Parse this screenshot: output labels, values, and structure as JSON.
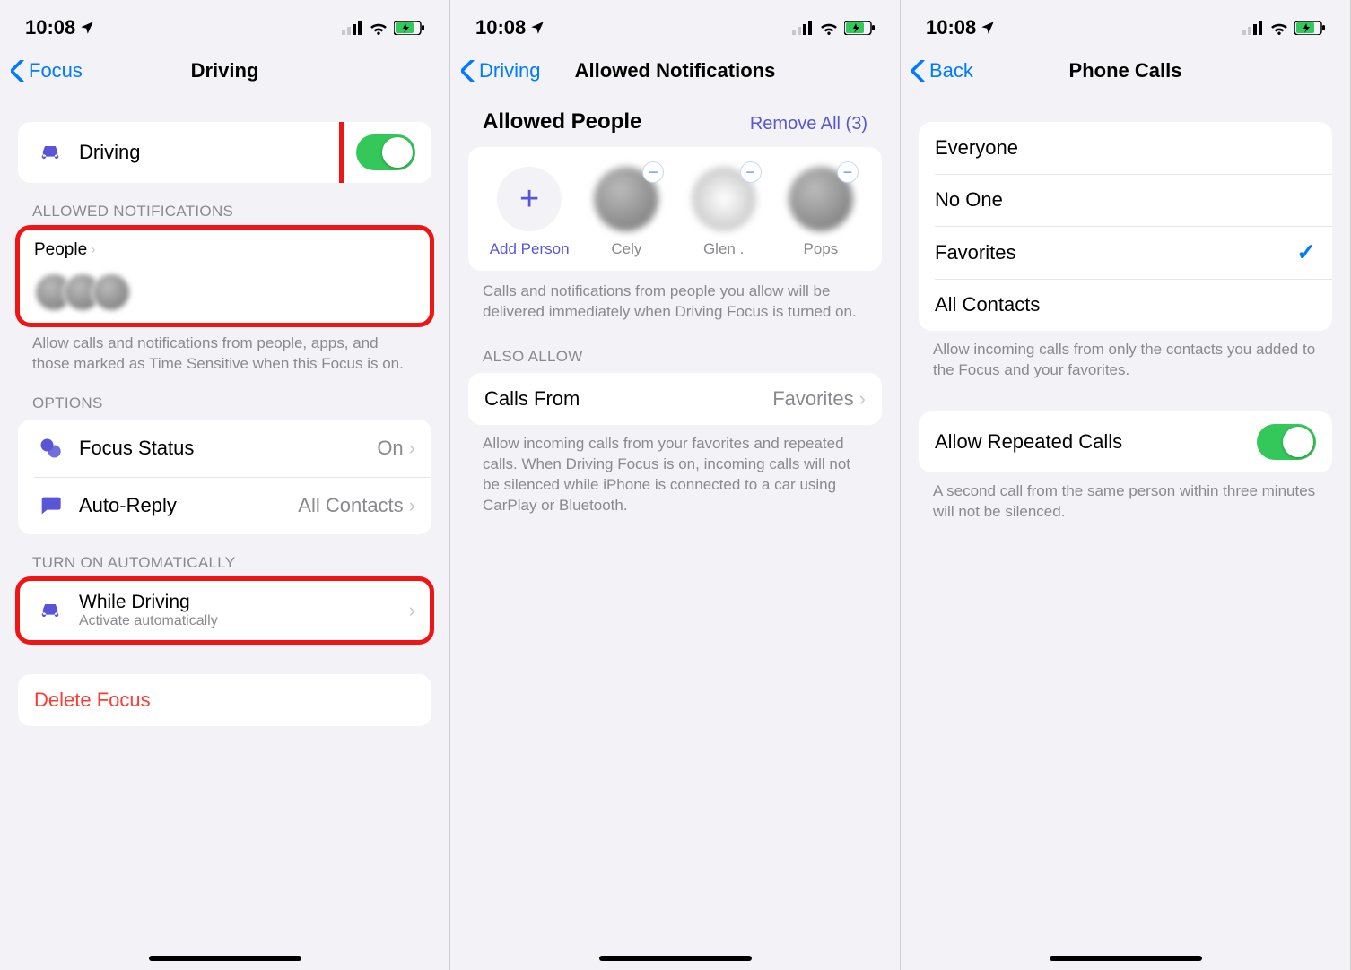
{
  "status": {
    "time": "10:08"
  },
  "screen1": {
    "back": "Focus",
    "title": "Driving",
    "toggle_row": {
      "label": "Driving",
      "on": true
    },
    "allowed_header": "ALLOWED NOTIFICATIONS",
    "people_row": {
      "label": "People"
    },
    "allowed_footer": "Allow calls and notifications from people, apps, and those marked as Time Sensitive when this Focus is on.",
    "options_header": "OPTIONS",
    "focus_status": {
      "label": "Focus Status",
      "value": "On"
    },
    "auto_reply": {
      "label": "Auto-Reply",
      "value": "All Contacts"
    },
    "auto_header": "TURN ON AUTOMATICALLY",
    "while_driving": {
      "label": "While Driving",
      "sub": "Activate automatically"
    },
    "delete": "Delete Focus"
  },
  "screen2": {
    "back": "Driving",
    "title": "Allowed Notifications",
    "section_title": "Allowed People",
    "remove_all": "Remove All (3)",
    "add_person": "Add Person",
    "people": [
      {
        "name": "Cely"
      },
      {
        "name": "Glen ."
      },
      {
        "name": "Pops"
      }
    ],
    "people_footer": "Calls and notifications from people you allow will be delivered immediately when Driving Focus is turned on.",
    "also_header": "ALSO ALLOW",
    "calls_from": {
      "label": "Calls From",
      "value": "Favorites"
    },
    "calls_footer": "Allow incoming calls from your favorites and repeated calls. When Driving Focus is on, incoming calls will not be silenced while iPhone is connected to a car using CarPlay or Bluetooth."
  },
  "screen3": {
    "back": "Back",
    "title": "Phone Calls",
    "options": [
      {
        "label": "Everyone",
        "selected": false
      },
      {
        "label": "No One",
        "selected": false
      },
      {
        "label": "Favorites",
        "selected": true
      },
      {
        "label": "All Contacts",
        "selected": false
      }
    ],
    "options_footer": "Allow incoming calls from only the contacts you added to the Focus and your favorites.",
    "repeated": {
      "label": "Allow Repeated Calls",
      "on": true
    },
    "repeated_footer": "A second call from the same person within three minutes will not be silenced."
  }
}
